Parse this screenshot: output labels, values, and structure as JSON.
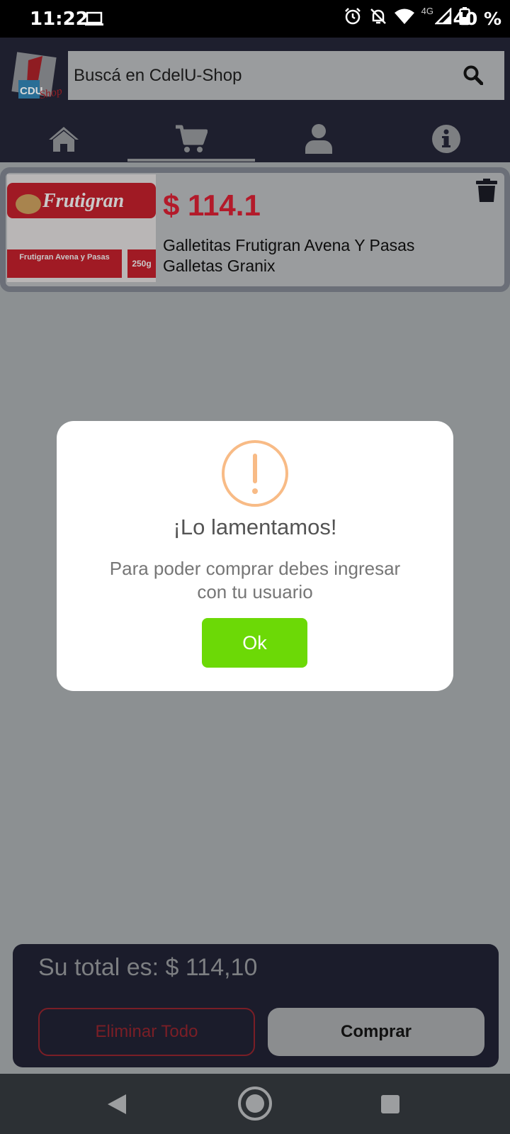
{
  "status_bar": {
    "time": "11:22",
    "network_label": "4G",
    "battery": "40 %"
  },
  "header": {
    "logo_text": "CDU",
    "logo_script": "Shop",
    "search_placeholder": "Buscá en CdelU-Shop",
    "tabs": [
      {
        "icon": "home-icon"
      },
      {
        "icon": "cart-icon",
        "active": true
      },
      {
        "icon": "user-icon"
      },
      {
        "icon": "info-icon"
      }
    ]
  },
  "cart": {
    "items": [
      {
        "price": "$ 114.1",
        "name": "Galletitas Frutigran Avena Y Pasas Galletas Granix",
        "image": {
          "brand": "Frutigran",
          "variant": "Frutigran Avena y Pasas",
          "weight": "250g"
        }
      }
    ]
  },
  "summary": {
    "total_text": "Su total es: $ 114,10",
    "delete_all_label": "Eliminar Todo",
    "buy_label": "Comprar"
  },
  "dialog": {
    "title": "¡Lo lamentamos!",
    "message": "Para poder comprar debes ingresar con tu usuario",
    "ok_label": "Ok"
  },
  "colors": {
    "accent_green": "#6cd906",
    "warning_orange": "#f8bb86",
    "price_red": "#b31a2a",
    "header_dark": "#1e1f2e"
  }
}
